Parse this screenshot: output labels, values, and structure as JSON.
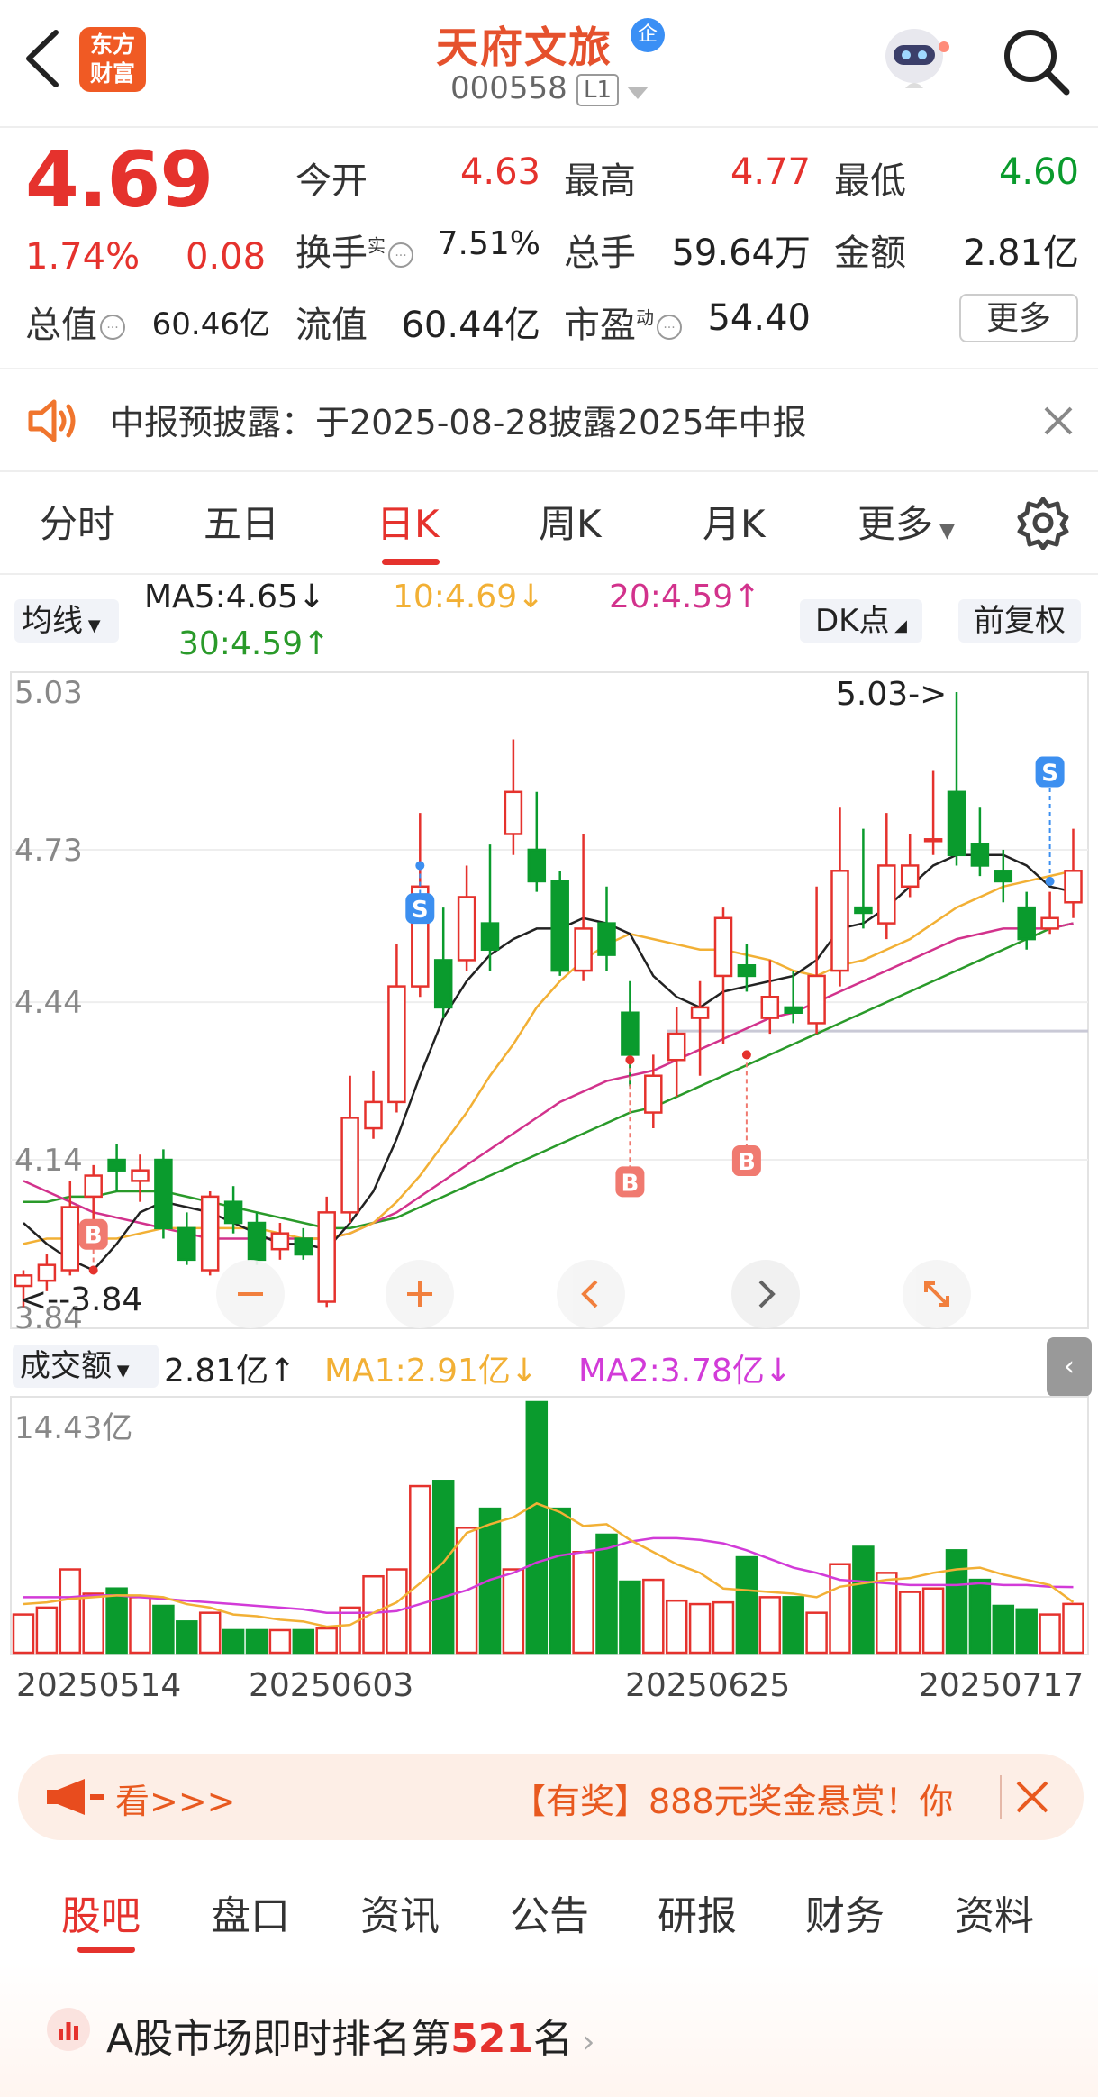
{
  "header": {
    "back_icon": "chevron-left-icon",
    "logo_text_line1": "东方",
    "logo_text_line2": "财富",
    "stock_name": "天府文旅",
    "enterprise_badge": "企",
    "stock_code": "000558",
    "level_badge": "L1",
    "avatar_icon": "robot-avatar-icon",
    "search_icon": "search-icon"
  },
  "quote": {
    "price": "4.69",
    "change_pct": "1.74%",
    "change": "0.08",
    "open_label": "今开",
    "open": "4.63",
    "high_label": "最高",
    "high": "4.77",
    "low_label": "最低",
    "low": "4.60",
    "turnover_label": "换手",
    "turnover_sup": "实",
    "turnover": "7.51%",
    "volume_label": "总手",
    "volume": "59.64万",
    "amount_label": "金额",
    "amount": "2.81亿",
    "mktcap_label": "总值",
    "mktcap": "60.46亿",
    "float_label": "流值",
    "float_cap": "60.44亿",
    "pe_label": "市盈",
    "pe_sup": "动",
    "pe": "54.40",
    "more_button": "更多"
  },
  "notice": {
    "icon": "speaker-icon",
    "text": "中报预披露：于2025-08-28披露2025年中报",
    "close_icon": "close-icon"
  },
  "chart_tabs": [
    "分时",
    "五日",
    "日K",
    "周K",
    "月K",
    "更多"
  ],
  "chart_tab_active": "日K",
  "settings_icon": "gear-icon",
  "ma_row": {
    "selector": "均线",
    "ma5": "MA5:4.65↓",
    "ma10": "10:4.69↓",
    "ma20": "20:4.59↑",
    "ma30": "30:4.59↑",
    "dk_button": "DK点",
    "adjust_button": "前复权"
  },
  "colors": {
    "up": "#e5322d",
    "down": "#0a9b2d",
    "ma5": "#222222",
    "ma10": "#f2b035",
    "ma20": "#d2328c",
    "ma30": "#2a9a2a",
    "accent": "#e5322d"
  },
  "volume_row": {
    "selector": "成交额",
    "value": "2.81亿↑",
    "ma1": "MA1:2.91亿↓",
    "ma2": "MA2:3.78亿↓",
    "collapse_icon": "chevron-left-icon"
  },
  "chart_nav_icons": [
    "minus-icon",
    "plus-icon",
    "chevron-left-icon",
    "chevron-right-icon",
    "expand-icon"
  ],
  "banner": {
    "icon": "megaphone-icon",
    "left_text": "看>>>",
    "right_text": "【有奖】888元奖金悬赏！你",
    "close_icon": "close-icon"
  },
  "bottom_tabs": [
    "股吧",
    "盘口",
    "资讯",
    "公告",
    "研报",
    "财务",
    "资料"
  ],
  "bottom_tab_active": "股吧",
  "ranking": {
    "prefix": "A股市场即时排名第",
    "rank": "521",
    "suffix": "名"
  },
  "chart_data": {
    "type": "candlestick",
    "price_axis_labels": [
      "5.03",
      "4.73",
      "4.44",
      "4.14",
      "3.84"
    ],
    "ylim": [
      3.84,
      5.03
    ],
    "max_marker": "5.03->",
    "min_marker": "<--3.84",
    "trade_markers": [
      "B",
      "B",
      "S",
      "S"
    ],
    "date_labels": [
      "20250514",
      "20250603",
      "20250625",
      "20250717"
    ],
    "candles": [
      [
        3.9,
        3.92,
        3.93,
        3.86
      ],
      [
        3.91,
        3.94,
        3.96,
        3.89
      ],
      [
        3.93,
        4.05,
        4.1,
        3.92
      ],
      [
        4.07,
        4.11,
        4.13,
        3.98
      ],
      [
        4.14,
        4.12,
        4.17,
        4.08
      ],
      [
        4.1,
        4.12,
        4.15,
        4.06
      ],
      [
        4.14,
        4.01,
        4.16,
        3.99
      ],
      [
        4.01,
        3.95,
        4.04,
        3.94
      ],
      [
        3.93,
        4.07,
        4.08,
        3.92
      ],
      [
        4.06,
        4.02,
        4.09,
        4.0
      ],
      [
        4.02,
        3.95,
        4.04,
        3.94
      ],
      [
        3.97,
        4.0,
        4.02,
        3.95
      ],
      [
        3.99,
        3.96,
        4.01,
        3.95
      ],
      [
        3.87,
        4.04,
        4.07,
        3.86
      ],
      [
        4.04,
        4.22,
        4.3,
        4.02
      ],
      [
        4.2,
        4.25,
        4.31,
        4.18
      ],
      [
        4.25,
        4.47,
        4.55,
        4.23
      ],
      [
        4.47,
        4.66,
        4.8,
        4.45
      ],
      [
        4.52,
        4.43,
        4.62,
        4.41
      ],
      [
        4.52,
        4.64,
        4.7,
        4.5
      ],
      [
        4.59,
        4.54,
        4.74,
        4.5
      ],
      [
        4.76,
        4.84,
        4.94,
        4.72
      ],
      [
        4.73,
        4.67,
        4.84,
        4.65
      ],
      [
        4.67,
        4.5,
        4.69,
        4.49
      ],
      [
        4.5,
        4.58,
        4.76,
        4.48
      ],
      [
        4.59,
        4.53,
        4.66,
        4.5
      ],
      [
        4.42,
        4.34,
        4.48,
        4.28
      ],
      [
        4.23,
        4.3,
        4.34,
        4.2
      ],
      [
        4.33,
        4.38,
        4.43,
        4.26
      ],
      [
        4.41,
        4.43,
        4.48,
        4.3
      ],
      [
        4.49,
        4.6,
        4.62,
        4.36
      ],
      [
        4.51,
        4.49,
        4.55,
        4.46
      ],
      [
        4.41,
        4.45,
        4.52,
        4.38
      ],
      [
        4.43,
        4.42,
        4.5,
        4.4
      ],
      [
        4.4,
        4.49,
        4.66,
        4.38
      ],
      [
        4.5,
        4.69,
        4.81,
        4.47
      ],
      [
        4.62,
        4.61,
        4.77,
        4.58
      ],
      [
        4.59,
        4.7,
        4.8,
        4.56
      ],
      [
        4.66,
        4.7,
        4.76,
        4.64
      ],
      [
        4.75,
        4.75,
        4.88,
        4.72
      ],
      [
        4.84,
        4.72,
        5.03,
        4.7
      ],
      [
        4.74,
        4.7,
        4.81,
        4.68
      ],
      [
        4.69,
        4.67,
        4.73,
        4.63
      ],
      [
        4.62,
        4.56,
        4.65,
        4.54
      ],
      [
        4.58,
        4.6,
        4.65,
        4.57
      ],
      [
        4.63,
        4.69,
        4.77,
        4.6
      ]
    ],
    "ma5": [
      4.02,
      3.98,
      3.95,
      3.93,
      3.98,
      4.04,
      4.06,
      4.05,
      4.04,
      4.02,
      4.0,
      3.98,
      3.98,
      3.97,
      4.02,
      4.08,
      4.18,
      4.3,
      4.41,
      4.48,
      4.53,
      4.56,
      4.58,
      4.58,
      4.6,
      4.59,
      4.57,
      4.49,
      4.45,
      4.43,
      4.46,
      4.47,
      4.48,
      4.49,
      4.52,
      4.58,
      4.59,
      4.62,
      4.66,
      4.7,
      4.72,
      4.72,
      4.72,
      4.7,
      4.66,
      4.65
    ],
    "ma10": [
      3.98,
      3.99,
      3.99,
      3.99,
      3.99,
      4.0,
      4.01,
      4.01,
      4.01,
      4.01,
      4.01,
      4.0,
      3.99,
      3.99,
      4.0,
      4.02,
      4.06,
      4.11,
      4.17,
      4.23,
      4.3,
      4.36,
      4.43,
      4.48,
      4.52,
      4.55,
      4.57,
      4.56,
      4.55,
      4.54,
      4.54,
      4.53,
      4.52,
      4.5,
      4.49,
      4.51,
      4.52,
      4.54,
      4.56,
      4.59,
      4.62,
      4.64,
      4.66,
      4.67,
      4.68,
      4.69
    ],
    "ma20": [
      4.1,
      4.08,
      4.06,
      4.04,
      4.03,
      4.02,
      4.01,
      4.0,
      3.99,
      3.99,
      3.99,
      3.99,
      3.99,
      3.99,
      4.0,
      4.02,
      4.04,
      4.07,
      4.1,
      4.13,
      4.16,
      4.19,
      4.22,
      4.25,
      4.27,
      4.29,
      4.3,
      4.31,
      4.33,
      4.35,
      4.37,
      4.39,
      4.41,
      4.42,
      4.44,
      4.46,
      4.48,
      4.5,
      4.52,
      4.54,
      4.56,
      4.57,
      4.58,
      4.58,
      4.58,
      4.59
    ],
    "ma30": [
      4.06,
      4.06,
      4.07,
      4.07,
      4.08,
      4.08,
      4.08,
      4.07,
      4.06,
      4.05,
      4.04,
      4.03,
      4.02,
      4.01,
      4.01,
      4.02,
      4.03,
      4.05,
      4.07,
      4.09,
      4.11,
      4.13,
      4.15,
      4.17,
      4.19,
      4.21,
      4.23,
      4.24,
      4.26,
      4.28,
      4.3,
      4.32,
      4.34,
      4.36,
      4.38,
      4.4,
      4.42,
      4.44,
      4.46,
      4.48,
      4.5,
      4.52,
      4.54,
      4.56,
      4.58,
      4.59
    ],
    "volume_axis_label": "14.43亿",
    "volume_max": 14.43,
    "volumes": [
      2.2,
      2.6,
      4.8,
      3.4,
      3.7,
      3.2,
      2.7,
      1.8,
      2.3,
      1.3,
      1.3,
      1.3,
      1.3,
      1.4,
      2.6,
      4.4,
      4.8,
      9.6,
      9.9,
      7.2,
      8.3,
      4.8,
      14.43,
      8.3,
      5.8,
      6.8,
      4.1,
      4.2,
      3.0,
      2.8,
      2.9,
      5.5,
      3.2,
      3.2,
      2.3,
      5.1,
      6.1,
      4.6,
      3.5,
      3.7,
      5.9,
      4.2,
      2.7,
      2.5,
      2.2,
      2.81
    ],
    "vol_ma1": [
      2.8,
      2.9,
      3.1,
      3.2,
      3.3,
      3.3,
      3.2,
      2.8,
      2.6,
      2.2,
      2.1,
      1.9,
      1.8,
      1.5,
      1.6,
      2.3,
      2.9,
      4.0,
      5.2,
      6.9,
      7.4,
      7.8,
      8.6,
      8.1,
      7.3,
      7.4,
      6.5,
      5.8,
      5.1,
      4.6,
      3.7,
      3.6,
      3.5,
      3.4,
      3.2,
      3.8,
      4.0,
      4.2,
      4.3,
      4.6,
      4.8,
      4.9,
      4.5,
      4.2,
      3.9,
      2.91
    ],
    "vol_ma2": [
      3.2,
      3.2,
      3.2,
      3.3,
      3.3,
      3.2,
      3.1,
      3.0,
      2.9,
      2.8,
      2.7,
      2.6,
      2.5,
      2.3,
      2.3,
      2.3,
      2.4,
      2.8,
      3.2,
      3.6,
      4.2,
      4.6,
      5.2,
      5.6,
      5.8,
      6.0,
      6.4,
      6.6,
      6.6,
      6.5,
      6.3,
      5.9,
      5.4,
      4.9,
      4.6,
      4.2,
      4.1,
      4.0,
      3.9,
      3.9,
      3.9,
      4.0,
      3.9,
      3.9,
      3.8,
      3.78
    ]
  }
}
